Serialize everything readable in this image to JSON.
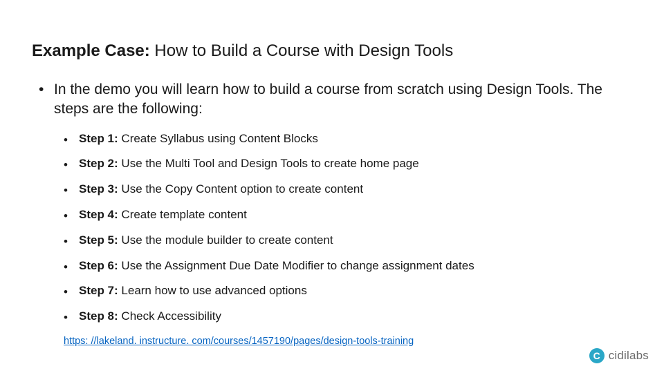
{
  "title": {
    "label": "Example Case:",
    "text": " How to Build a Course with Design Tools"
  },
  "intro": {
    "bullet": "•",
    "text": "In the demo you will learn how to build a course from scratch using Design Tools. The steps are the following:"
  },
  "steps": [
    {
      "bullet": "•",
      "label": "Step 1:",
      "text": " Create Syllabus using Content Blocks"
    },
    {
      "bullet": "•",
      "label": "Step 2:",
      "text": " Use the Multi Tool and Design Tools to create home page"
    },
    {
      "bullet": "•",
      "label": "Step 3:",
      "text": " Use the Copy Content option to create content"
    },
    {
      "bullet": "•",
      "label": "Step 4:",
      "text": " Create template content"
    },
    {
      "bullet": "•",
      "label": "Step 5:",
      "text": " Use the module builder to create content"
    },
    {
      "bullet": "•",
      "label": "Step 6:",
      "text": " Use the Assignment Due Date Modifier to change assignment dates"
    },
    {
      "bullet": "•",
      "label": "Step 7:",
      "text": " Learn how to use advanced options"
    },
    {
      "bullet": "•",
      "label": "Step 8:",
      "text": " Check Accessibility"
    }
  ],
  "link": {
    "text": "https: //lakeland. instructure. com/courses/1457190/pages/design-tools-training"
  },
  "brand": {
    "mark": "C",
    "name": "cidilabs"
  }
}
